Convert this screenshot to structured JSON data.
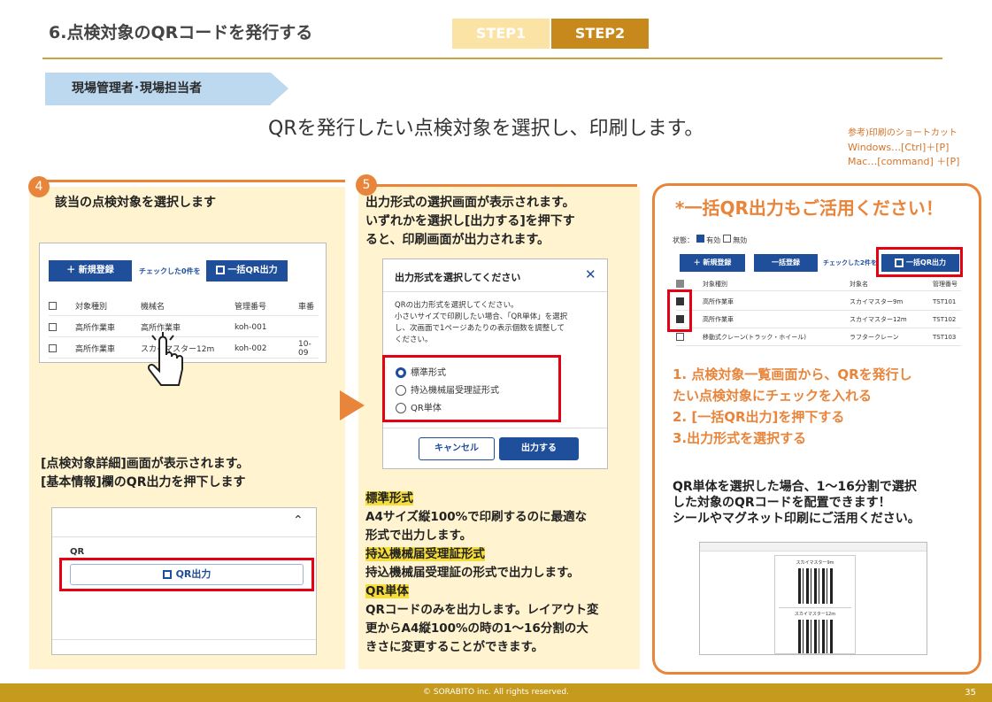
{
  "header": {
    "title": "6.点検対象のQRコードを発行する",
    "step1": "STEP1",
    "step2": "STEP2"
  },
  "role_tag": "現場管理者･現場担当者",
  "main_title": "QRを発行したい点検対象を選択し、印刷します。",
  "shortcut": {
    "line1": "参考)印刷のショートカット",
    "line2": "Windows…[Ctrl]＋[P]",
    "line3": "Mac…[command] ＋[P]"
  },
  "step4": {
    "number": "4",
    "heading": "該当の点検対象を選択します",
    "shot": {
      "new_button": "＋ 新規登録",
      "checked_label": "チェックした0件を",
      "bulk_qr_button": "一括QR出力",
      "columns": [
        "対象種別",
        "機械名",
        "管理番号",
        "車番"
      ],
      "rows": [
        [
          "高所作業車",
          "高所作業車",
          "koh-001",
          ""
        ],
        [
          "高所作業車",
          "スカイマスター12m",
          "koh-002",
          "10-09"
        ]
      ]
    },
    "detail_text1": "[点検対象詳細]画面が表示されます。",
    "detail_text2": "[基本情報]欄のQR出力を押下します",
    "detail_shot": {
      "section_label": "QR",
      "qr_button": "QR出力"
    }
  },
  "step5": {
    "number": "5",
    "heading1": "出力形式の選択画面が表示されます。",
    "heading2": "いずれかを選択し[出力する]を押下す",
    "heading3": "ると、印刷画面が出力されます。",
    "dialog": {
      "title": "出力形式を選択してください",
      "desc1": "QRの出力形式を選択してください。",
      "desc2": "小さいサイズで印刷したい場合、「QR単体」を選択",
      "desc3": "し、次画面で1ページあたりの表示個数を調整して",
      "desc4": "ください。",
      "options": [
        "標準形式",
        "持込機械届受理証形式",
        "QR単体"
      ],
      "cancel": "キャンセル",
      "submit": "出力する"
    },
    "fmt1_title": "標準形式",
    "fmt1_desc1": "A4サイズ縦100%で印刷するのに最適な",
    "fmt1_desc2": "形式で出力します。",
    "fmt2_title": "持込機械届受理証形式",
    "fmt2_desc": "持込機械届受理証の形式で出力します。",
    "fmt3_title": "QR単体",
    "fmt3_desc1": "QRコードのみを出力します。レイアウト変",
    "fmt3_desc2": "更からA4縦100%の時の1～16分割の大",
    "fmt3_desc3": "きさに変更することができます。"
  },
  "card": {
    "title": "*一括QR出力もご活用ください！",
    "shot": {
      "status_label": "状態：",
      "status_on": "有効",
      "status_off": "無効",
      "new_button": "＋ 新規登録",
      "bulk_button": "一括登録",
      "checked_label": "チェックした2件を",
      "bulk_qr_button": "一括QR出力",
      "columns": [
        "対象種別",
        "対象名",
        "管理番号"
      ],
      "rows": [
        [
          "高所作業車",
          "スカイマスター9m",
          "TST101"
        ],
        [
          "高所作業車",
          "スカイマスター12m",
          "TST102"
        ],
        [
          "移動式クレーン(トラック・ホイール)",
          "ラフタークレーン",
          "TST103"
        ]
      ]
    },
    "step_a1": "1. 点検対象一覧画面から、QRを発行し",
    "step_a2": "たい点検対象にチェックを入れる",
    "step_b": "2. [一括QR出力]を押下する",
    "step_c": "3.出力形式を選択する",
    "note1": "QR単体を選択した場合、1～16分割で選択",
    "note2": "した対象のQRコードを配置できます！",
    "note3": "シールやマグネット印刷にご活用ください。",
    "preview": {
      "label1": "スカイマスター9m",
      "label2": "スカイマスター12m"
    }
  },
  "footer": {
    "copyright": "© SORABITO inc. All rights reserved.",
    "page": "35"
  }
}
